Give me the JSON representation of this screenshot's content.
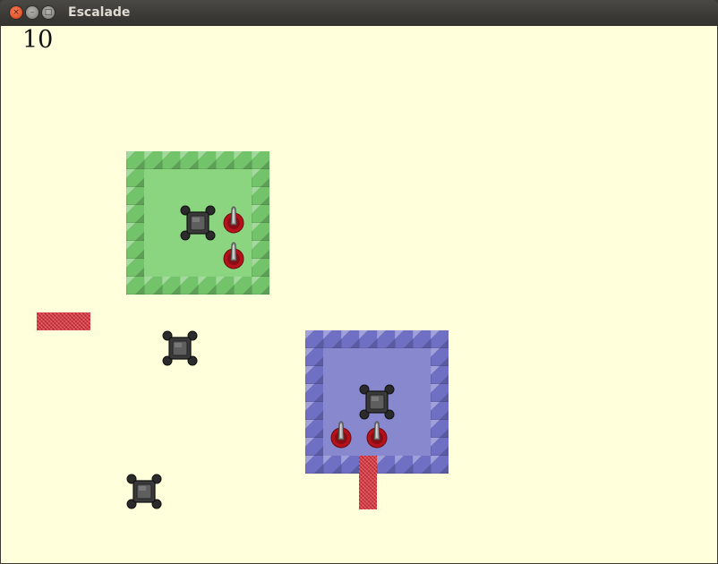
{
  "window": {
    "title": "Escalade",
    "close_glyph": "×",
    "min_glyph": "–",
    "max_glyph": "□"
  },
  "hud": {
    "score": "10"
  },
  "colors": {
    "background": "#ffffdc",
    "green_room": "#8bd581",
    "blue_room": "#8888cf",
    "barrier": "#d63a44"
  },
  "icons": {
    "tank": "tank-icon",
    "cannon": "cannon-icon"
  }
}
